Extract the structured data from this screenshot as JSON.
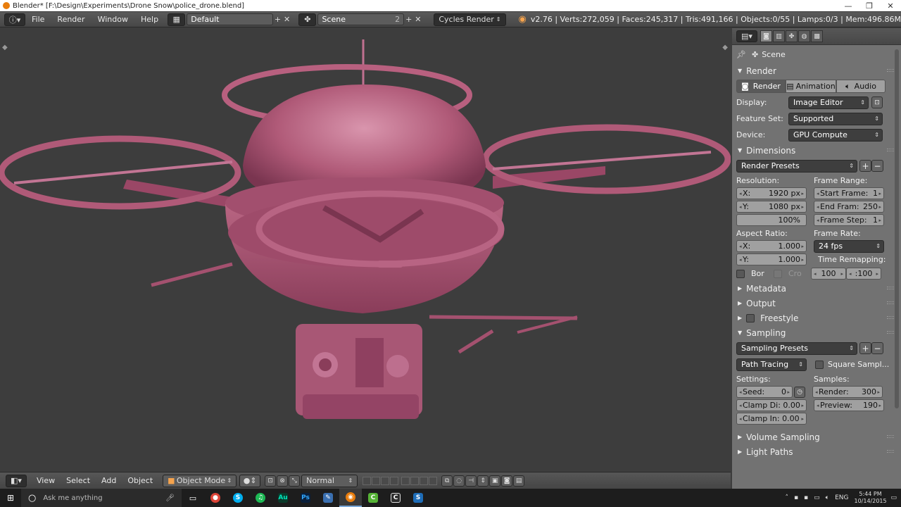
{
  "titlebar": {
    "title": "Blender* [F:\\Design\\Experiments\\Drone Snow\\police_drone.blend]",
    "controls": [
      "—",
      "❐",
      "✕"
    ]
  },
  "infobar": {
    "menus": [
      "File",
      "Render",
      "Window",
      "Help"
    ],
    "layout": "Default",
    "scene": "Scene",
    "scene_users": "2",
    "engine": "Cycles Render",
    "stats": "v2.76 | Verts:272,059 | Faces:245,317 | Tris:491,166 | Objects:0/55 | Lamps:0/3 | Mem:496.86M"
  },
  "viewport_header": {
    "menus": [
      "View",
      "Select",
      "Add",
      "Object"
    ],
    "mode": "Object Mode",
    "orientation": "Normal"
  },
  "properties": {
    "context": "Scene",
    "render": {
      "title": "Render",
      "buttons": [
        "Render",
        "Animation",
        "Audio"
      ],
      "display_label": "Display:",
      "display_value": "Image Editor",
      "feature_label": "Feature Set:",
      "feature_value": "Supported",
      "device_label": "Device:",
      "device_value": "GPU Compute"
    },
    "dimensions": {
      "title": "Dimensions",
      "presets": "Render Presets",
      "resolution_label": "Resolution:",
      "res_x": "1920 px",
      "res_y": "1080 px",
      "res_pct": "100%",
      "x_label": "X:",
      "y_label": "Y:",
      "frame_range_label": "Frame Range:",
      "start_label": "Start Frame:",
      "start_value": "1",
      "end_label": "End Fram:",
      "end_value": "250",
      "step_label": "Frame Step:",
      "step_value": "1",
      "aspect_label": "Aspect Ratio:",
      "aspect_x": "1.000",
      "aspect_y": "1.000",
      "frame_rate_label": "Frame Rate:",
      "frame_rate_value": "24 fps",
      "time_remap_label": "Time Remapping:",
      "remap_old": "100",
      "remap_new": ":100",
      "border_label": "Bor",
      "crop_label": "Cro"
    },
    "collapsed": [
      "Metadata",
      "Output",
      "Freestyle"
    ],
    "sampling": {
      "title": "Sampling",
      "presets": "Sampling Presets",
      "method": "Path Tracing",
      "square_label": "Square Sampl...",
      "settings_label": "Settings:",
      "samples_label": "Samples:",
      "seed_label": "Seed:",
      "seed_value": "0",
      "clamp_direct": "Clamp Di: 0.00",
      "clamp_indirect": "Clamp In: 0.00",
      "render_label": "Render:",
      "render_value": "300",
      "preview_label": "Preview:",
      "preview_value": "190"
    },
    "more": [
      "Volume Sampling",
      "Light Paths"
    ]
  },
  "taskbar": {
    "search_placeholder": "Ask me anything",
    "time": "5:44 PM",
    "date": "10/14/2015",
    "lang": "ENG"
  },
  "colors": {
    "model": "#b05a78",
    "model_dark": "#7a3550",
    "model_light": "#d98aa6",
    "viewport_bg": "#3d3d3d",
    "panel_bg": "#727272"
  }
}
